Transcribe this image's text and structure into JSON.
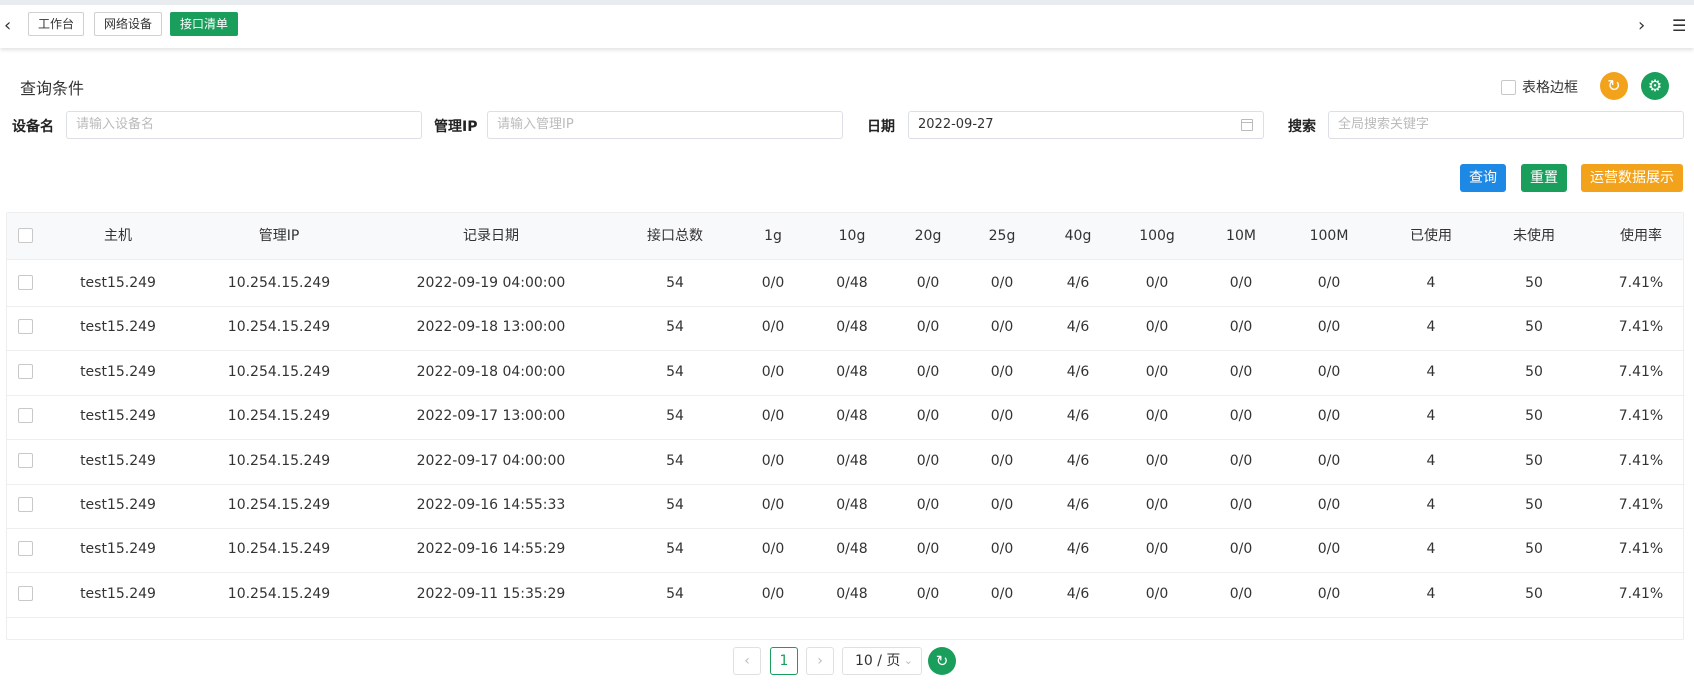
{
  "tabs": [
    {
      "label": "工作台"
    },
    {
      "label": "网络设备"
    },
    {
      "label": "接口清单"
    }
  ],
  "query": {
    "title": "查询条件",
    "border_toggle_label": "表格边框",
    "device_label": "设备名",
    "device_placeholder": "请输入设备名",
    "ip_label": "管理IP",
    "ip_placeholder": "请输入管理IP",
    "date_label": "日期",
    "date_value": "2022-09-27",
    "search_label": "搜索",
    "search_placeholder": "全局搜索关键字"
  },
  "actions": {
    "query": "查询",
    "reset": "重置",
    "ops": "运营数据展示"
  },
  "table": {
    "headers": [
      "主机",
      "管理IP",
      "记录日期",
      "接口总数",
      "1g",
      "10g",
      "20g",
      "25g",
      "40g",
      "100g",
      "10M",
      "100M",
      "已使用",
      "未使用",
      "使用率"
    ],
    "rows": [
      [
        "test15.249",
        "10.254.15.249",
        "2022-09-19 04:00:00",
        "54",
        "0/0",
        "0/48",
        "0/0",
        "0/0",
        "4/6",
        "0/0",
        "0/0",
        "0/0",
        "4",
        "50",
        "7.41%"
      ],
      [
        "test15.249",
        "10.254.15.249",
        "2022-09-18 13:00:00",
        "54",
        "0/0",
        "0/48",
        "0/0",
        "0/0",
        "4/6",
        "0/0",
        "0/0",
        "0/0",
        "4",
        "50",
        "7.41%"
      ],
      [
        "test15.249",
        "10.254.15.249",
        "2022-09-18 04:00:00",
        "54",
        "0/0",
        "0/48",
        "0/0",
        "0/0",
        "4/6",
        "0/0",
        "0/0",
        "0/0",
        "4",
        "50",
        "7.41%"
      ],
      [
        "test15.249",
        "10.254.15.249",
        "2022-09-17 13:00:00",
        "54",
        "0/0",
        "0/48",
        "0/0",
        "0/0",
        "4/6",
        "0/0",
        "0/0",
        "0/0",
        "4",
        "50",
        "7.41%"
      ],
      [
        "test15.249",
        "10.254.15.249",
        "2022-09-17 04:00:00",
        "54",
        "0/0",
        "0/48",
        "0/0",
        "0/0",
        "4/6",
        "0/0",
        "0/0",
        "0/0",
        "4",
        "50",
        "7.41%"
      ],
      [
        "test15.249",
        "10.254.15.249",
        "2022-09-16 14:55:33",
        "54",
        "0/0",
        "0/48",
        "0/0",
        "0/0",
        "4/6",
        "0/0",
        "0/0",
        "0/0",
        "4",
        "50",
        "7.41%"
      ],
      [
        "test15.249",
        "10.254.15.249",
        "2022-09-16 14:55:29",
        "54",
        "0/0",
        "0/48",
        "0/0",
        "0/0",
        "4/6",
        "0/0",
        "0/0",
        "0/0",
        "4",
        "50",
        "7.41%"
      ],
      [
        "test15.249",
        "10.254.15.249",
        "2022-09-11 15:35:29",
        "54",
        "0/0",
        "0/48",
        "0/0",
        "0/0",
        "4/6",
        "0/0",
        "0/0",
        "0/0",
        "4",
        "50",
        "7.41%"
      ]
    ]
  },
  "pagination": {
    "current_page": "1",
    "page_size": "10 / 页"
  },
  "icons": {
    "prev": "chevron-left-icon",
    "next": "chevron-right-icon",
    "menu": "menu-icon",
    "refresh": "refresh-icon",
    "settings": "gear-icon",
    "calendar": "calendar-icon"
  },
  "colors": {
    "primary_green": "#1a9e5c",
    "blue": "#1e88e5",
    "orange": "#f2a31b"
  }
}
